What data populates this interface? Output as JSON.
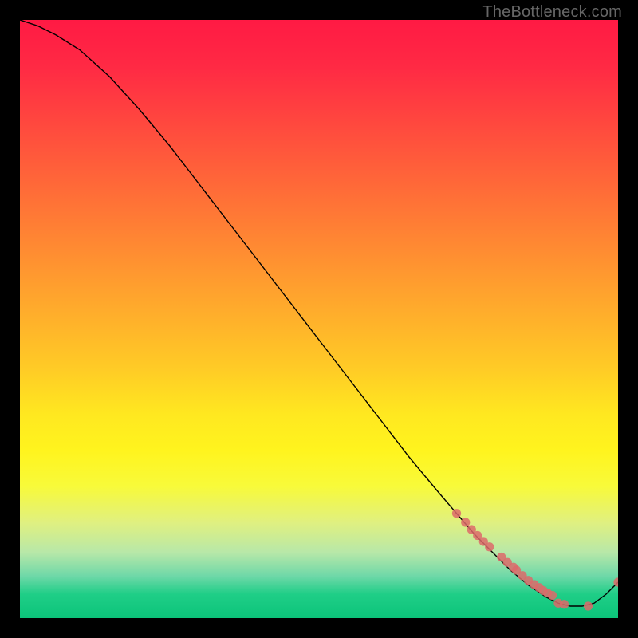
{
  "watermark": "TheBottleneck.com",
  "chart_data": {
    "type": "line",
    "title": "",
    "xlabel": "",
    "ylabel": "",
    "xlim": [
      0,
      100
    ],
    "ylim": [
      0,
      100
    ],
    "series": [
      {
        "name": "curve",
        "x": [
          0,
          3,
          6,
          10,
          15,
          20,
          25,
          30,
          35,
          40,
          45,
          50,
          55,
          60,
          65,
          70,
          73,
          76,
          79,
          82,
          85,
          88,
          90,
          92,
          94,
          96,
          98,
          100
        ],
        "y": [
          100,
          99,
          97.5,
          95,
          90.5,
          85,
          79,
          72.5,
          66,
          59.5,
          53,
          46.5,
          40,
          33.5,
          27,
          21,
          17.5,
          14,
          11,
          8,
          5.5,
          3.5,
          2.5,
          2,
          2,
          2.5,
          4,
          6
        ]
      }
    ],
    "highlight_points": {
      "name": "dots",
      "x": [
        73,
        74.5,
        75.5,
        76.5,
        77.5,
        78.5,
        80.5,
        81.5,
        82.5,
        83,
        84,
        85,
        86,
        86.8,
        87.5,
        88.2,
        89,
        90,
        91,
        95,
        100
      ],
      "y": [
        17.5,
        16,
        14.8,
        13.8,
        12.8,
        11.9,
        10.2,
        9.3,
        8.5,
        8.0,
        7.1,
        6.3,
        5.6,
        5.1,
        4.6,
        4.2,
        3.8,
        2.5,
        2.3,
        2,
        6
      ]
    }
  }
}
